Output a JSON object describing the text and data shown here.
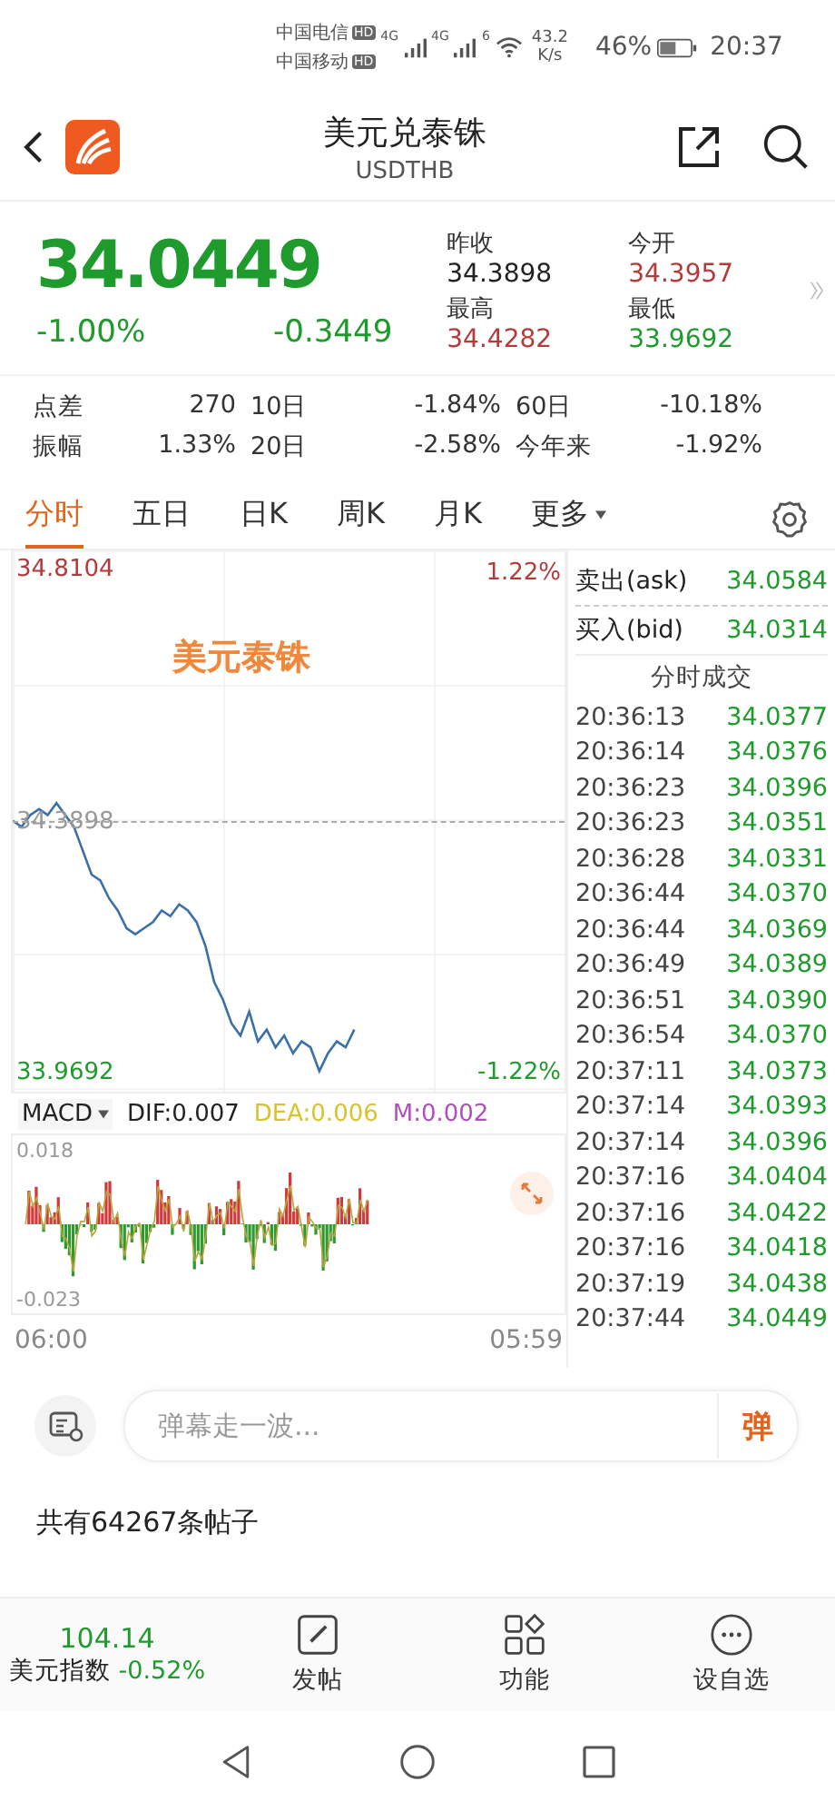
{
  "status_bar": {
    "carrier_1": "中国电信",
    "carrier_2": "中国移动",
    "hd_badges": [
      "HD",
      "HD"
    ],
    "net_1": "4G",
    "net_2": "4G",
    "wifi": "6",
    "speed": "43.2",
    "speed_unit": "K/s",
    "battery": "46%",
    "time": "20:37"
  },
  "header": {
    "title": "美元兑泰铢",
    "subtitle": "USDTHB"
  },
  "quote": {
    "price": "34.0449",
    "change_pct": "-1.00%",
    "change": "-0.3449",
    "fields": [
      {
        "label": "昨收",
        "value": "34.3898",
        "color": "#222222"
      },
      {
        "label": "今开",
        "value": "34.3957",
        "color": "#b53a3a"
      },
      {
        "label": "最高",
        "value": "34.4282",
        "color": "#b53a3a"
      },
      {
        "label": "最低",
        "value": "33.9692",
        "color": "#1f9a2c"
      }
    ]
  },
  "stats": [
    {
      "label": "点差",
      "value": "270"
    },
    {
      "label": "10日",
      "value": "-1.84%"
    },
    {
      "label": "60日",
      "value": "-10.18%"
    },
    {
      "label": "振幅",
      "value": "1.33%"
    },
    {
      "label": "20日",
      "value": "-2.58%"
    },
    {
      "label": "今年来",
      "value": "-1.92%"
    }
  ],
  "tabs": [
    {
      "label": "分时",
      "selected": true,
      "kind": "tab"
    },
    {
      "label": "五日",
      "selected": false,
      "kind": "tab"
    },
    {
      "label": "日K",
      "selected": false,
      "kind": "tab"
    },
    {
      "label": "周K",
      "selected": false,
      "kind": "tab"
    },
    {
      "label": "月K",
      "selected": false,
      "kind": "tab"
    },
    {
      "label": "更多",
      "selected": false,
      "kind": "dropdown"
    }
  ],
  "chart": {
    "high_pct": "1.22%",
    "overlay": "美元泰铢",
    "low_pct": "-1.22%",
    "indicator": "MACD",
    "dif": "DIF:0.007",
    "dea": "DEA:0.006",
    "m": "M:0.002",
    "macd_high": "0.018",
    "macd_low": "-0.023",
    "start_time": "06:00",
    "end_time": "05:59",
    "chart_data": {
      "type": "line",
      "categories": [
        null,
        null,
        null,
        null,
        null,
        null,
        null,
        null,
        null,
        null,
        null,
        null,
        null,
        null,
        null,
        null,
        null,
        null,
        null,
        null,
        null,
        null,
        null,
        null,
        null,
        null,
        null,
        null,
        null,
        null,
        null,
        null,
        null,
        null,
        null,
        null,
        null,
        null,
        null,
        null,
        null,
        null,
        null,
        null,
        null,
        null,
        null,
        null,
        null,
        null,
        null,
        null,
        null,
        null,
        null,
        null,
        null,
        null,
        null,
        null,
        null,
        null,
        null,
        null
      ],
      "ylim": [
        33.9357,
        34.8439
      ],
      "yticks": [
        {
          "value": 34.8104,
          "label": "34.8104"
        },
        {
          "value": 34.3898,
          "label": "34.3898"
        },
        {
          "value": 33.9692,
          "label": "33.9692"
        }
      ],
      "series": [
        {
          "color": "#3b6fa8",
          "values": [
            34.39,
            34.38,
            34.4,
            34.41,
            34.4,
            34.42,
            34.4,
            34.38,
            34.34,
            34.3,
            34.29,
            34.26,
            34.24,
            34.21,
            34.2,
            34.21,
            34.22,
            34.24,
            34.23,
            34.25,
            34.24,
            34.22,
            34.18,
            34.12,
            34.09,
            34.05,
            34.03,
            34.07,
            34.02,
            34.04,
            34.01,
            34.03,
            34.0,
            34.02,
            34.01,
            33.97,
            34.0,
            34.02,
            34.01,
            34.04,
            null,
            null,
            null,
            null,
            null,
            null,
            null,
            null,
            null,
            null,
            null,
            null,
            null,
            null,
            null,
            null,
            null,
            null,
            null,
            null,
            null,
            null,
            null,
            null
          ]
        }
      ]
    }
  },
  "book": {
    "ask": {
      "label": "卖出(ask)",
      "value": "34.0584"
    },
    "bid": {
      "label": "买入(bid)",
      "value": "34.0314"
    },
    "trades_title": "分时成交",
    "trades": [
      {
        "time": "20:36:13",
        "price": "34.0377"
      },
      {
        "time": "20:36:14",
        "price": "34.0376"
      },
      {
        "time": "20:36:23",
        "price": "34.0396"
      },
      {
        "time": "20:36:23",
        "price": "34.0351"
      },
      {
        "time": "20:36:28",
        "price": "34.0331"
      },
      {
        "time": "20:36:44",
        "price": "34.0370"
      },
      {
        "time": "20:36:44",
        "price": "34.0369"
      },
      {
        "time": "20:36:49",
        "price": "34.0389"
      },
      {
        "time": "20:36:51",
        "price": "34.0390"
      },
      {
        "time": "20:36:54",
        "price": "34.0370"
      },
      {
        "time": "20:37:11",
        "price": "34.0373"
      },
      {
        "time": "20:37:14",
        "price": "34.0393"
      },
      {
        "time": "20:37:14",
        "price": "34.0396"
      },
      {
        "time": "20:37:16",
        "price": "34.0404"
      },
      {
        "time": "20:37:16",
        "price": "34.0422"
      },
      {
        "time": "20:37:16",
        "price": "34.0418"
      },
      {
        "time": "20:37:19",
        "price": "34.0438"
      },
      {
        "time": "20:37:44",
        "price": "34.0449"
      }
    ]
  },
  "comment": {
    "placeholder": "弹幕走一波...",
    "send": "弹"
  },
  "post_count": "共有64267条帖子",
  "bottom_nav": {
    "index": {
      "value": "104.14",
      "name": "美元指数",
      "change": "-0.52%"
    },
    "items": [
      {
        "label": "发帖",
        "kind": "post"
      },
      {
        "label": "功能",
        "kind": "apps"
      },
      {
        "label": "设自选",
        "kind": "more"
      }
    ]
  }
}
